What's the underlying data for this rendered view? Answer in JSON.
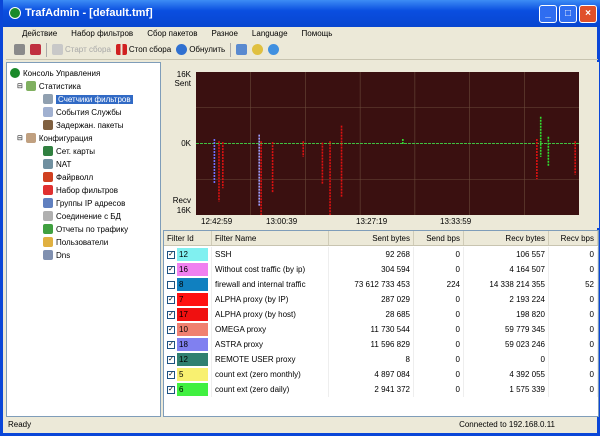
{
  "window": {
    "title": "TrafAdmin - [default.tmf]"
  },
  "menu": [
    "Действие",
    "Набор фильтров",
    "Сбор пакетов",
    "Разное",
    "Language",
    "Помощь"
  ],
  "toolbar": {
    "start": "Старт сбора",
    "stop": "Стоп сбора",
    "reset": "Обнулить"
  },
  "tree": {
    "root": "Консоль Управления",
    "stats": "Статистика",
    "stat_items": [
      "Счетчики фильтров",
      "События Службы",
      "Задержан. пакеты"
    ],
    "config": "Конфигурация",
    "config_items": [
      "Сет. карты",
      "NAT",
      "Файрволл",
      "Набор фильтров",
      "Группы IP адресов",
      "Соединение с БД",
      "Отчеты по трафику",
      "Пользователи",
      "Dns"
    ]
  },
  "chart_data": {
    "type": "line",
    "y_top_label": "16K",
    "y_top_sub": "Sent",
    "y_mid_label": "0K",
    "y_bot_label": "Recv",
    "y_bot_sub": "16K",
    "ylim": [
      -16000,
      16000
    ],
    "xlim": [
      0,
      100
    ],
    "x_ticks": [
      "12:42:59",
      "13:00:39",
      "13:27:19",
      "13:33:59"
    ],
    "grid": true,
    "spikes": [
      {
        "x": 4.8,
        "sent": 1000,
        "recv": 9000,
        "color": "#7070ff"
      },
      {
        "x": 6,
        "sent": 500,
        "recv": 13000,
        "color": "#e01010"
      },
      {
        "x": 7,
        "sent": 300,
        "recv": 10000,
        "color": "#e01010"
      },
      {
        "x": 16.5,
        "sent": 2000,
        "recv": 14000,
        "color": "#a0a0ff"
      },
      {
        "x": 17,
        "sent": 500,
        "recv": 16000,
        "color": "#e01010"
      },
      {
        "x": 20,
        "sent": 300,
        "recv": 11000,
        "color": "#e01010"
      },
      {
        "x": 28,
        "sent": 500,
        "recv": 3000,
        "color": "#e01010"
      },
      {
        "x": 33,
        "sent": 200,
        "recv": 9000,
        "color": "#e01010"
      },
      {
        "x": 35,
        "sent": 500,
        "recv": 16000,
        "color": "#e01010"
      },
      {
        "x": 38,
        "sent": 4000,
        "recv": 12000,
        "color": "#e01010"
      },
      {
        "x": 54,
        "sent": 1000,
        "recv": 200,
        "color": "#30e030"
      },
      {
        "x": 89,
        "sent": 1000,
        "recv": 8000,
        "color": "#e01010"
      },
      {
        "x": 90,
        "sent": 6000,
        "recv": 3000,
        "color": "#30e030"
      },
      {
        "x": 92,
        "sent": 1500,
        "recv": 5000,
        "color": "#30e030"
      },
      {
        "x": 99,
        "sent": 500,
        "recv": 7000,
        "color": "#e01010"
      }
    ]
  },
  "table": {
    "columns": [
      "Filter Id",
      "Filter Name",
      "Sent bytes",
      "Send bps",
      "Recv bytes",
      "Recv bps"
    ],
    "rows": [
      {
        "checked": true,
        "id": "12",
        "color": "#80f0f0",
        "name": "SSH",
        "sent": "92 268",
        "sbps": "0",
        "recv": "106 557",
        "rbps": "0"
      },
      {
        "checked": true,
        "id": "16",
        "color": "#f080f0",
        "name": "Without cost traffic (by ip)",
        "sent": "304 594",
        "sbps": "0",
        "recv": "4 164 507",
        "rbps": "0"
      },
      {
        "checked": false,
        "id": "8",
        "color": "#1080c0",
        "name": "firewall and internal traffic",
        "sent": "73 612 733 453",
        "sbps": "224",
        "recv": "14 338 214 355",
        "rbps": "52"
      },
      {
        "checked": true,
        "id": "7",
        "color": "#ff1010",
        "name": "ALPHA proxy (by IP)",
        "sent": "287 029",
        "sbps": "0",
        "recv": "2 193 224",
        "rbps": "0"
      },
      {
        "checked": true,
        "id": "17",
        "color": "#f01010",
        "name": "ALPHA proxy (by host)",
        "sent": "28 685",
        "sbps": "0",
        "recv": "198 820",
        "rbps": "0"
      },
      {
        "checked": true,
        "id": "10",
        "color": "#f08070",
        "name": "OMEGA proxy",
        "sent": "11 730 544",
        "sbps": "0",
        "recv": "59 779 345",
        "rbps": "0"
      },
      {
        "checked": true,
        "id": "18",
        "color": "#8080f0",
        "name": "ASTRA proxy",
        "sent": "11 596 829",
        "sbps": "0",
        "recv": "59 023 246",
        "rbps": "0"
      },
      {
        "checked": true,
        "id": "12",
        "color": "#308070",
        "name": "REMOTE USER proxy",
        "sent": "8",
        "sbps": "0",
        "recv": "0",
        "rbps": "0"
      },
      {
        "checked": true,
        "id": "5",
        "color": "#f8f070",
        "name": "count ext (zero monthly)",
        "sent": "4 897 084",
        "sbps": "0",
        "recv": "4 392 055",
        "rbps": "0"
      },
      {
        "checked": true,
        "id": "6",
        "color": "#40f040",
        "name": "count ext (zero daily)",
        "sent": "2 941 372",
        "sbps": "0",
        "recv": "1 575 339",
        "rbps": "0"
      }
    ]
  },
  "status": {
    "left": "Ready",
    "right": "Connected to 192.168.0.11"
  }
}
